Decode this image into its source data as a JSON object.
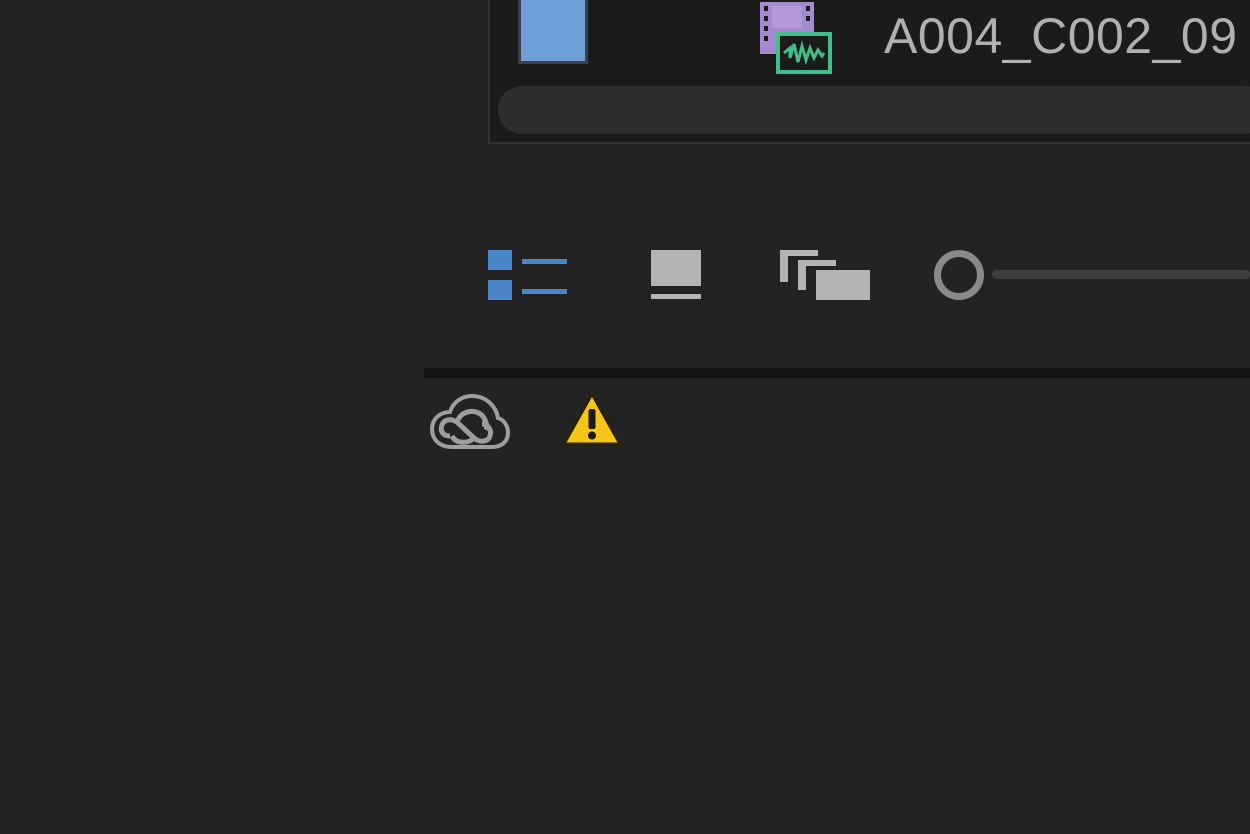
{
  "project_panel": {
    "clip": {
      "name": "A004_C002_09",
      "label_color": "#6f9fd8",
      "type_icon": "video-audio-clip-icon"
    },
    "scrollbar": "horizontal-scrollbar"
  },
  "toolbar": {
    "list_view_icon": "list-view-icon",
    "icon_view_icon": "icon-view-icon",
    "freeform_view_icon": "freeform-view-icon",
    "zoom_slider": {
      "thumb_icon": "slider-thumb",
      "value": 0
    },
    "active_color": "#4b86c8"
  },
  "status_bar": {
    "creative_cloud_icon": "creative-cloud-icon",
    "warning_icon": "warning-icon",
    "warning_color": "#f5c518"
  }
}
